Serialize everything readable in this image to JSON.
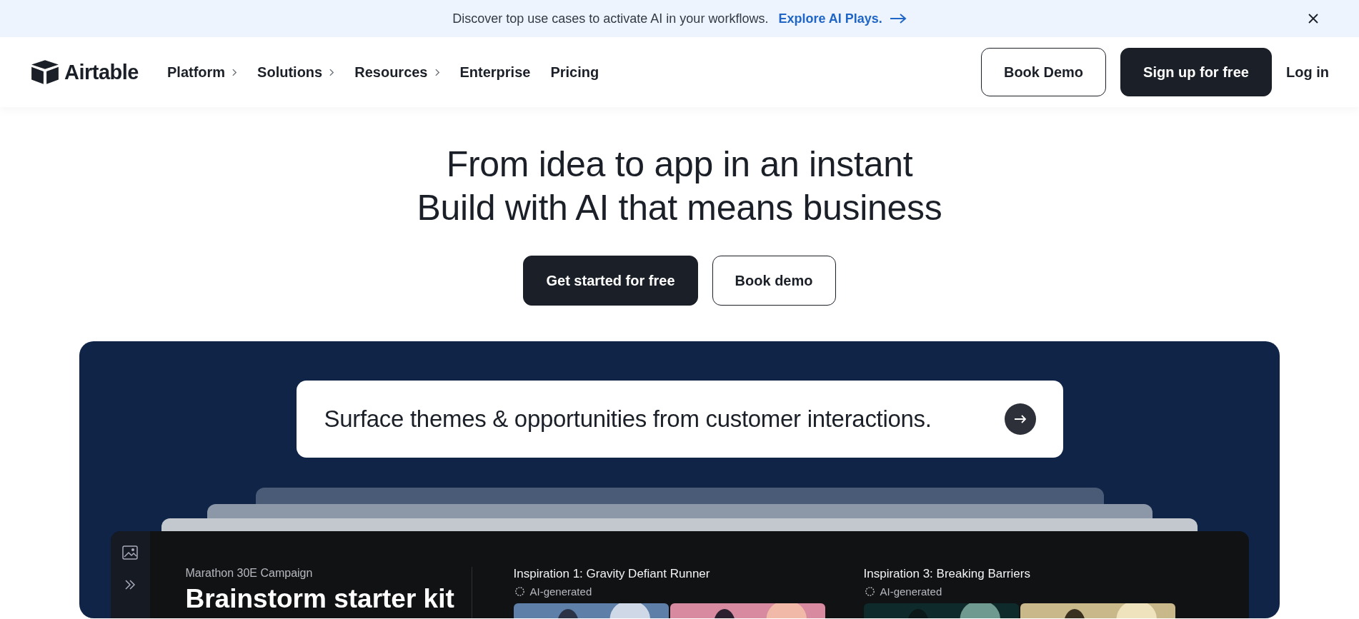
{
  "banner": {
    "text": "Discover top use cases to activate AI in your workflows.",
    "link": "Explore AI Plays."
  },
  "nav": {
    "logo": "Airtable",
    "items": [
      {
        "label": "Platform",
        "has_menu": true
      },
      {
        "label": "Solutions",
        "has_menu": true
      },
      {
        "label": "Resources",
        "has_menu": true
      },
      {
        "label": "Enterprise",
        "has_menu": false
      },
      {
        "label": "Pricing",
        "has_menu": false
      }
    ],
    "buttons": [
      {
        "label": "Book Demo",
        "kind": "outline"
      },
      {
        "label": "Sign up for free",
        "kind": "filled"
      },
      {
        "label": "Log in",
        "kind": "plain"
      }
    ]
  },
  "hero": {
    "title_lines": [
      "From idea to app in an instant",
      "Build with AI that means business"
    ],
    "buttons": [
      {
        "label": "Get started for free",
        "kind": "filled"
      },
      {
        "label": "Book demo",
        "kind": "outline"
      }
    ]
  },
  "demo": {
    "prompt": "Surface themes & opportunities from customer interactions.",
    "app": {
      "subtitle": "Marathon 30E Campaign",
      "title": "Brainstorm starter kit",
      "inspirations": [
        {
          "title": "Inspiration 1: Gravity Defiant Runner",
          "tag": "AI-generated"
        },
        {
          "title": "Inspiration 3: Breaking Barriers",
          "tag": "AI-generated"
        }
      ]
    }
  }
}
